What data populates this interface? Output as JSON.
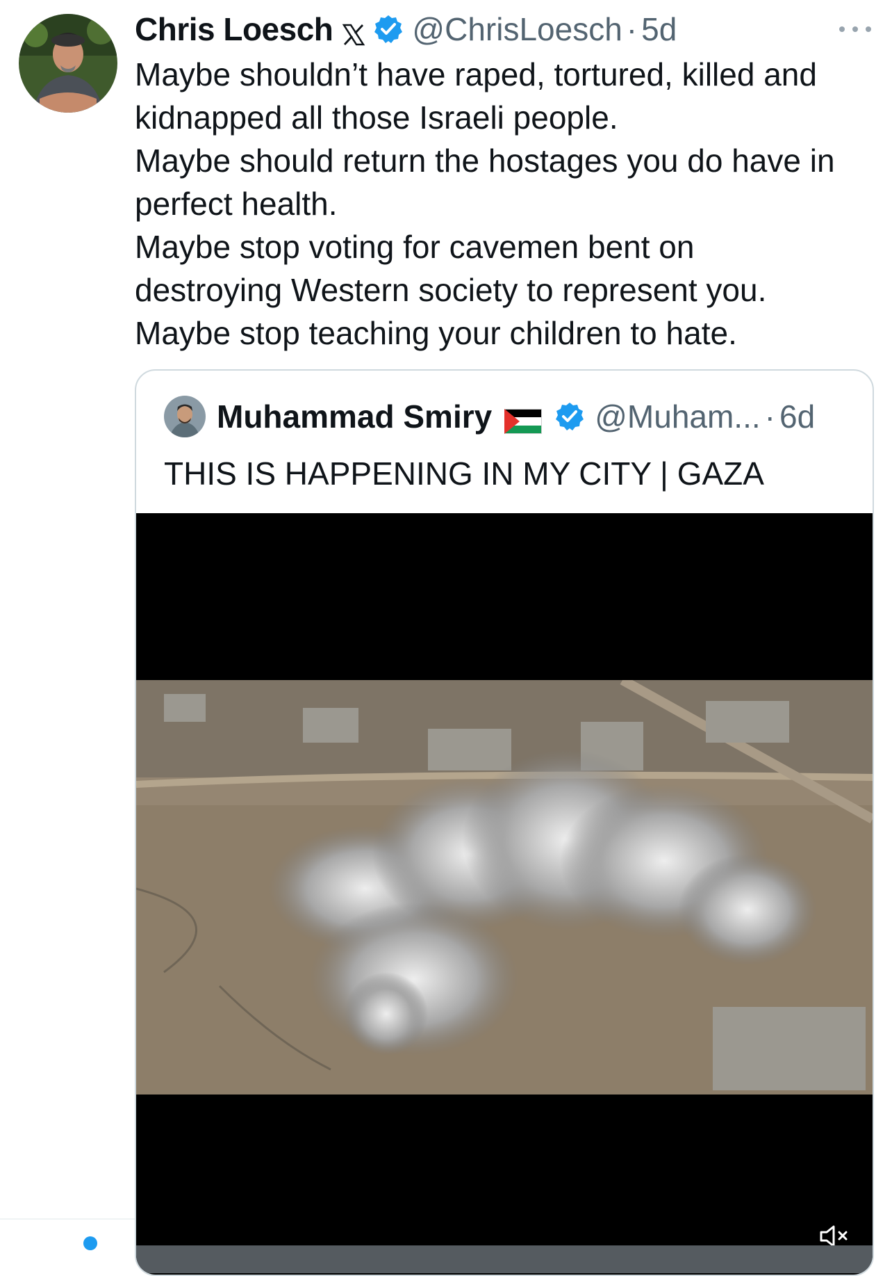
{
  "tweet": {
    "author_name": "Chris Loesch",
    "handle": "@ChrisLoesch",
    "separator": "·",
    "time": "5d",
    "badges": [
      "x-logo-icon",
      "verified-icon"
    ],
    "text_lines": [
      "Maybe shouldn’t have raped, tortured, killed and",
      "kidnapped all those Israeli people.",
      "Maybe should return the hostages you do have in",
      "perfect health.",
      "Maybe stop voting for cavemen bent on",
      "destroying Western society to represent you.",
      "Maybe stop teaching your children to hate."
    ]
  },
  "quoted_tweet": {
    "author_name": "Muhammad Smiry",
    "flag_icon": "palestine-flag-icon",
    "handle": "@Muham...",
    "separator": "·",
    "time": "6d",
    "text": "THIS IS HAPPENING IN MY CITY | GAZA",
    "media": {
      "type": "video",
      "muted": true,
      "icons": [
        "muted-speaker-icon"
      ]
    }
  },
  "colors": {
    "text_primary": "#0f1419",
    "text_secondary": "#536471",
    "verified_blue": "#1d9bf0",
    "border": "#cfd9de",
    "video_background": "#000000"
  }
}
